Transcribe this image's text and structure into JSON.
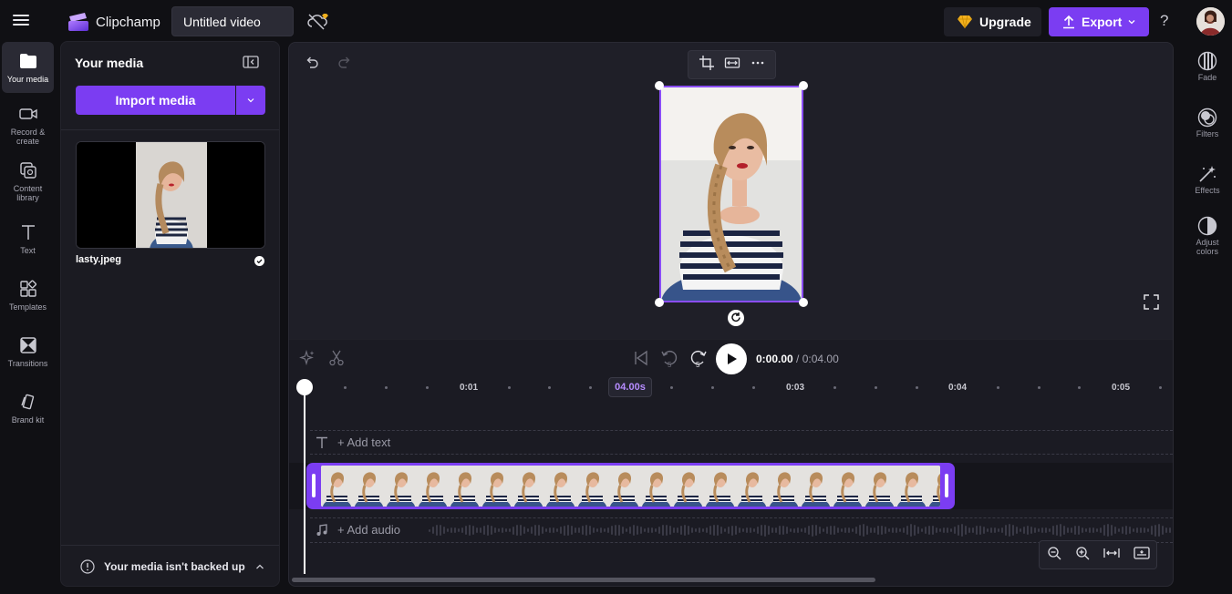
{
  "app": {
    "name": "Clipchamp",
    "project_title": "Untitled video"
  },
  "header": {
    "upgrade_label": "Upgrade",
    "export_label": "Export",
    "help_label": "?"
  },
  "left_rail": [
    {
      "label": "Your media",
      "icon": "folder-icon"
    },
    {
      "label": "Record & create",
      "icon": "camera-icon"
    },
    {
      "label": "Content library",
      "icon": "library-icon"
    },
    {
      "label": "Text",
      "icon": "text-icon"
    },
    {
      "label": "Templates",
      "icon": "templates-icon"
    },
    {
      "label": "Transitions",
      "icon": "transitions-icon"
    },
    {
      "label": "Brand kit",
      "icon": "brand-kit-icon"
    }
  ],
  "media_panel": {
    "title": "Your media",
    "import_label": "Import media",
    "files": [
      {
        "name": "lasty.jpeg"
      }
    ],
    "backup_warning": "Your media isn't backed up"
  },
  "right_rail": [
    {
      "label": "Fade",
      "icon": "fade-icon"
    },
    {
      "label": "Filters",
      "icon": "filters-icon"
    },
    {
      "label": "Effects",
      "icon": "effects-icon"
    },
    {
      "label": "Adjust colors",
      "icon": "adjust-colors-icon"
    }
  ],
  "playback": {
    "current_time": "0:00.00",
    "separator": " / ",
    "total_time": "0:04.00",
    "rewind_seconds": "5",
    "forward_seconds": "5"
  },
  "ruler": {
    "labels": [
      "0:01",
      "0:03",
      "0:04",
      "0:05"
    ],
    "clip_duration_badge": "04.00s"
  },
  "timeline": {
    "add_text_label": "+ Add text",
    "add_audio_label": "+ Add audio"
  },
  "colors": {
    "accent": "#7b3df2",
    "background": "#101014",
    "panel": "#1b1b22"
  }
}
